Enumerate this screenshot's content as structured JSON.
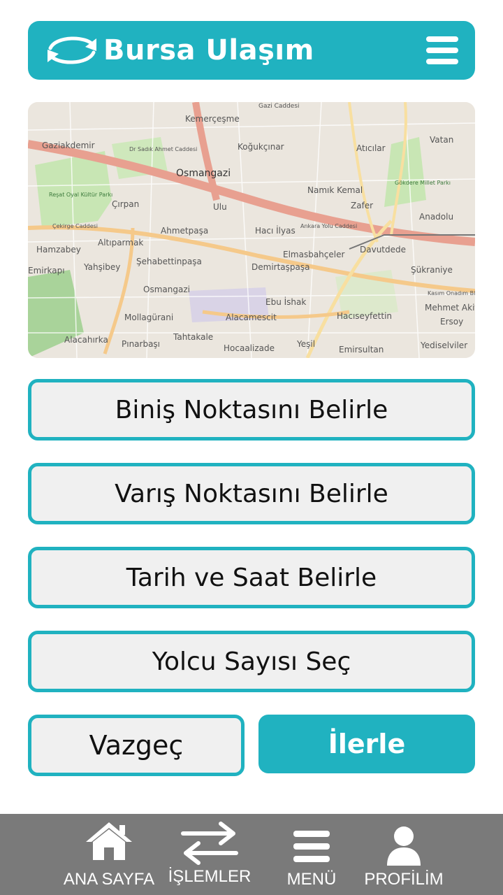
{
  "header": {
    "title": "Bursa Ulaşım",
    "logo_icon": "refresh-arrows-icon",
    "menu_icon": "hamburger-icon"
  },
  "map": {
    "labels": [
      "Gazi Caddesi",
      "Kemerçeşme",
      "Gaziakdemir",
      "Dr Sadık Ahmet Caddesi",
      "Koğukçınar",
      "Atıcılar",
      "Vatan",
      "Osmangazi",
      "Reşat Oyal Kültür Parkı",
      "Gökdere Millet Parkı",
      "Namık Kemal",
      "Çırpan",
      "Ulu",
      "Zafer",
      "Anadolu",
      "Çekirge Caddesi",
      "Ahmetpaşa",
      "Hacı İlyas",
      "Ankara Yolu Caddesi",
      "Altıparmak",
      "Elmasbahçeler",
      "Davutdede",
      "Hamzabey",
      "Şehabettinpaşa",
      "Demirtaşpaşa",
      "Yahşibey",
      "Şükraniye",
      "Emirkapı",
      "Osmangazi",
      "Kasım Onadım Bl.",
      "Ebu İshak",
      "Mehmet Akif",
      "Mollagürani",
      "Alacamescit",
      "Hacıseyfettin",
      "Ersoy",
      "Alacahırka",
      "Tahtakale",
      "Pınarbaşı",
      "Hocaalizade",
      "Yeşil",
      "Emirsultan",
      "Yediselviler"
    ]
  },
  "options": {
    "pickup": "Biniş Noktasını Belirle",
    "destination": "Varış Noktasını Belirle",
    "datetime": "Tarih ve Saat Belirle",
    "passengers": "Yolcu Sayısı Seç"
  },
  "actions": {
    "cancel": "Vazgeç",
    "next": "İlerle"
  },
  "nav": {
    "items": [
      {
        "label": "ANA SAYFA",
        "icon": "home-icon"
      },
      {
        "label": "İŞLEMLER",
        "icon": "swap-arrows-icon"
      },
      {
        "label": "MENÜ",
        "icon": "menu-icon"
      },
      {
        "label": "PROFİLİM",
        "icon": "user-icon"
      }
    ]
  },
  "colors": {
    "accent": "#20b2c0",
    "button_bg": "#f0f0f0",
    "nav_bg": "#7a7a7a"
  }
}
